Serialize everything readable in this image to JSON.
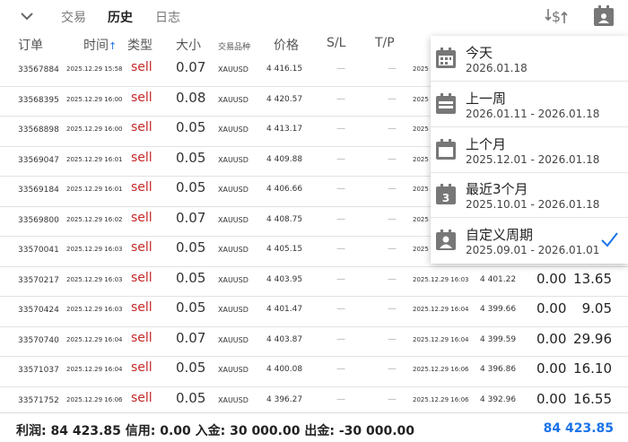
{
  "tabs": {
    "trade": "交易",
    "history": "历史",
    "journal": "日志"
  },
  "columns": {
    "order": "订单",
    "time": "时间",
    "sort_indicator": "↑",
    "type": "类型",
    "volume": "大小",
    "symbol": "交易品种",
    "price": "价格",
    "sl": "S/L",
    "tp": "T/P"
  },
  "rows": [
    {
      "id": "33567884",
      "open_time": "2025.12.29 15:58",
      "type": "sell",
      "volume": "0.07",
      "symbol": "XAUUSD",
      "price": "4 416.15",
      "sl": "—",
      "tp": "—",
      "close_time": "2025",
      "close_price": "",
      "swap": "",
      "profit": ""
    },
    {
      "id": "33568395",
      "open_time": "2025.12.29 16:00",
      "type": "sell",
      "volume": "0.08",
      "symbol": "XAUUSD",
      "price": "4 420.57",
      "sl": "—",
      "tp": "—",
      "close_time": "2025",
      "close_price": "",
      "swap": "",
      "profit": ""
    },
    {
      "id": "33568898",
      "open_time": "2025.12.29 16:00",
      "type": "sell",
      "volume": "0.05",
      "symbol": "XAUUSD",
      "price": "4 413.17",
      "sl": "—",
      "tp": "—",
      "close_time": "2025",
      "close_price": "",
      "swap": "",
      "profit": ""
    },
    {
      "id": "33569047",
      "open_time": "2025.12.29 16:01",
      "type": "sell",
      "volume": "0.05",
      "symbol": "XAUUSD",
      "price": "4 409.88",
      "sl": "—",
      "tp": "—",
      "close_time": "2025",
      "close_price": "",
      "swap": "",
      "profit": ""
    },
    {
      "id": "33569184",
      "open_time": "2025.12.29 16:01",
      "type": "sell",
      "volume": "0.05",
      "symbol": "XAUUSD",
      "price": "4 406.66",
      "sl": "—",
      "tp": "—",
      "close_time": "2025",
      "close_price": "",
      "swap": "",
      "profit": ""
    },
    {
      "id": "33569800",
      "open_time": "2025.12.29 16:02",
      "type": "sell",
      "volume": "0.07",
      "symbol": "XAUUSD",
      "price": "4 408.75",
      "sl": "—",
      "tp": "—",
      "close_time": "2025",
      "close_price": "",
      "swap": "",
      "profit": ""
    },
    {
      "id": "33570041",
      "open_time": "2025.12.29 16:03",
      "type": "sell",
      "volume": "0.05",
      "symbol": "XAUUSD",
      "price": "4 405.15",
      "sl": "—",
      "tp": "—",
      "close_time": "2025",
      "close_price": "",
      "swap": "",
      "profit": ""
    },
    {
      "id": "33570217",
      "open_time": "2025.12.29 16:03",
      "type": "sell",
      "volume": "0.05",
      "symbol": "XAUUSD",
      "price": "4 403.95",
      "sl": "—",
      "tp": "—",
      "close_time": "2025.12.29 16:03",
      "close_price": "4 401.22",
      "swap": "0.00",
      "profit": "13.65"
    },
    {
      "id": "33570424",
      "open_time": "2025.12.29 16:03",
      "type": "sell",
      "volume": "0.05",
      "symbol": "XAUUSD",
      "price": "4 401.47",
      "sl": "—",
      "tp": "—",
      "close_time": "2025.12.29 16:04",
      "close_price": "4 399.66",
      "swap": "0.00",
      "profit": "9.05"
    },
    {
      "id": "33570740",
      "open_time": "2025.12.29 16:04",
      "type": "sell",
      "volume": "0.07",
      "symbol": "XAUUSD",
      "price": "4 403.87",
      "sl": "—",
      "tp": "—",
      "close_time": "2025.12.29 16:04",
      "close_price": "4 399.59",
      "swap": "0.00",
      "profit": "29.96"
    },
    {
      "id": "33571037",
      "open_time": "2025.12.29 16:04",
      "type": "sell",
      "volume": "0.05",
      "symbol": "XAUUSD",
      "price": "4 400.08",
      "sl": "—",
      "tp": "—",
      "close_time": "2025.12.29 16:06",
      "close_price": "4 396.86",
      "swap": "0.00",
      "profit": "16.10"
    },
    {
      "id": "33571752",
      "open_time": "2025.12.29 16:06",
      "type": "sell",
      "volume": "0.05",
      "symbol": "XAUUSD",
      "price": "4 396.27",
      "sl": "—",
      "tp": "—",
      "close_time": "2025.12.29 16:06",
      "close_price": "4 392.96",
      "swap": "0.00",
      "profit": "16.55"
    }
  ],
  "footer": {
    "summary": "利润:  84 423.85  信用:  0.00  入金:  30 000.00  出金:  -30 000.00",
    "total": "84 423.85"
  },
  "period_menu": [
    {
      "title": "今天",
      "range": "2026.01.18",
      "icon": "calendar-day-icon",
      "selected": false
    },
    {
      "title": "上一周",
      "range": "2026.01.11 - 2026.01.18",
      "icon": "calendar-week-icon",
      "selected": false
    },
    {
      "title": "上个月",
      "range": "2025.12.01 - 2026.01.18",
      "icon": "calendar-month-icon",
      "selected": false
    },
    {
      "title": "最近3个月",
      "range": "2025.10.01 - 2026.01.18",
      "icon": "calendar-3months-icon",
      "icon_text": "3",
      "selected": false
    },
    {
      "title": "自定义周期",
      "range": "2025.09.01 - 2026.01.01",
      "icon": "calendar-custom-icon",
      "selected": true
    }
  ],
  "colors": {
    "accent": "#1a73e8",
    "sell": "#c62828",
    "icon_gray": "#777777"
  }
}
